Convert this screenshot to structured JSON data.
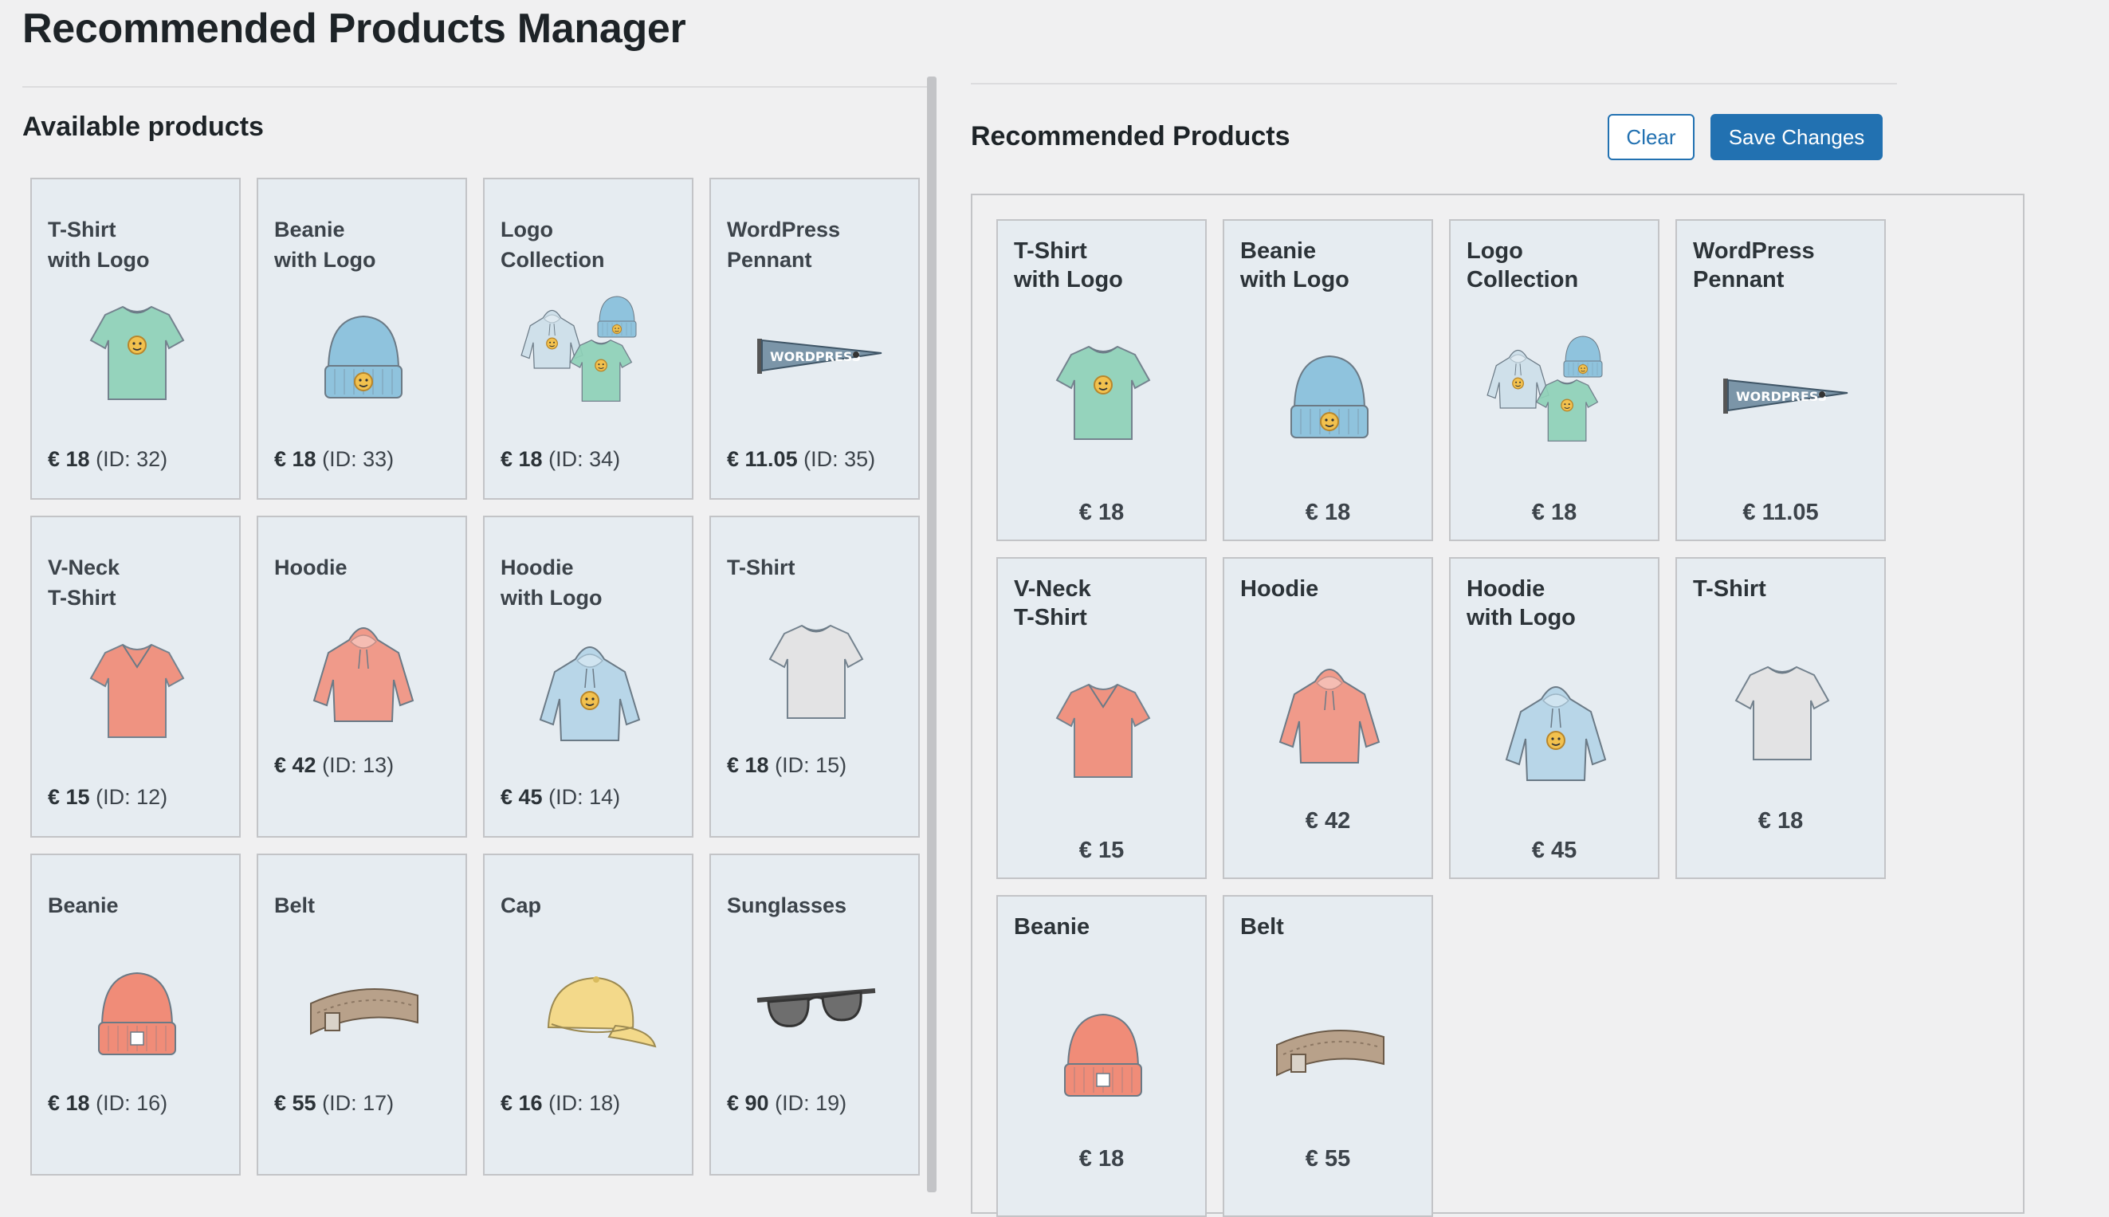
{
  "page": {
    "title": "Recommended Products Manager"
  },
  "available": {
    "heading": "Available products",
    "products": [
      {
        "name": "T-Shirt\nwith Logo",
        "price": "€ 18",
        "id_label": "(ID: 32)",
        "icon": "tshirt-logo",
        "color": "#8fd1b8"
      },
      {
        "name": "Beanie\nwith Logo",
        "price": "€ 18",
        "id_label": "(ID: 33)",
        "icon": "beanie-logo",
        "color": "#8fc3dd"
      },
      {
        "name": "Logo\nCollection",
        "price": "€ 18",
        "id_label": "(ID: 34)",
        "icon": "logo-collection",
        "color": "#8fd1b8"
      },
      {
        "name": "WordPress\nPennant",
        "price": "€ 11.05",
        "id_label": "(ID: 35)",
        "icon": "pennant",
        "color": "#7b95a8"
      },
      {
        "name": "V-Neck\nT-Shirt",
        "price": "€ 15",
        "id_label": "(ID: 12)",
        "icon": "vneck",
        "color": "#f08c78"
      },
      {
        "name": "Hoodie",
        "price": "€ 42",
        "id_label": "(ID: 13)",
        "icon": "hoodie",
        "color": "#f09a8a"
      },
      {
        "name": "Hoodie\nwith Logo",
        "price": "€ 45",
        "id_label": "(ID: 14)",
        "icon": "hoodie-logo",
        "color": "#b8d6e8"
      },
      {
        "name": "T-Shirt",
        "price": "€ 18",
        "id_label": "(ID: 15)",
        "icon": "tshirt",
        "color": "#e3e3e3"
      },
      {
        "name": "Beanie",
        "price": "€ 18",
        "id_label": "(ID: 16)",
        "icon": "beanie",
        "color": "#f08c78"
      },
      {
        "name": "Belt",
        "price": "€ 55",
        "id_label": "(ID: 17)",
        "icon": "belt",
        "color": "#b8a18a"
      },
      {
        "name": "Cap",
        "price": "€ 16",
        "id_label": "(ID: 18)",
        "icon": "cap",
        "color": "#f3d98a"
      },
      {
        "name": "Sunglasses",
        "price": "€ 90",
        "id_label": "(ID: 19)",
        "icon": "sunglasses",
        "color": "#6e6e6e"
      }
    ]
  },
  "recommended": {
    "heading": "Recommended Products",
    "clear_label": "Clear",
    "save_label": "Save Changes",
    "products": [
      {
        "name": "T-Shirt\nwith Logo",
        "price": "€ 18",
        "icon": "tshirt-logo",
        "color": "#8fd1b8"
      },
      {
        "name": "Beanie\nwith Logo",
        "price": "€ 18",
        "icon": "beanie-logo",
        "color": "#8fc3dd"
      },
      {
        "name": "Logo\nCollection",
        "price": "€ 18",
        "icon": "logo-collection",
        "color": "#8fd1b8"
      },
      {
        "name": "WordPress\nPennant",
        "price": "€ 11.05",
        "icon": "pennant",
        "color": "#7b95a8"
      },
      {
        "name": "V-Neck\nT-Shirt",
        "price": "€ 15",
        "icon": "vneck",
        "color": "#f08c78"
      },
      {
        "name": "Hoodie",
        "price": "€ 42",
        "icon": "hoodie",
        "color": "#f09a8a"
      },
      {
        "name": "Hoodie\nwith Logo",
        "price": "€ 45",
        "icon": "hoodie-logo",
        "color": "#b8d6e8"
      },
      {
        "name": "T-Shirt",
        "price": "€ 18",
        "icon": "tshirt",
        "color": "#e3e3e3"
      },
      {
        "name": "Beanie",
        "price": "€ 18",
        "icon": "beanie",
        "color": "#f08c78"
      },
      {
        "name": "Belt",
        "price": "€ 55",
        "icon": "belt",
        "color": "#b8a18a"
      }
    ]
  },
  "colors": {
    "accent": "#2271b1",
    "card_bg": "#e6ecf1",
    "card_border": "#c3c4c7",
    "page_bg": "#f0f0f1"
  }
}
